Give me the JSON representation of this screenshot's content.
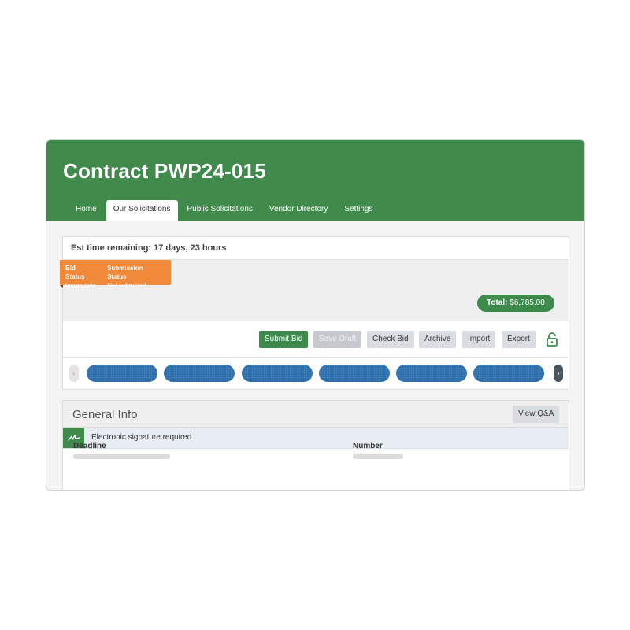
{
  "header": {
    "title": "Contract PWP24-015",
    "background": "#408a4c",
    "nav": [
      {
        "label": "Home",
        "active": false
      },
      {
        "label": "Our Solicitations",
        "active": true
      },
      {
        "label": "Public Solicitations",
        "active": false
      },
      {
        "label": "Vendor Directory",
        "active": false
      },
      {
        "label": "Settings",
        "active": false
      }
    ]
  },
  "bid": {
    "time_remaining": "Est time remaining: 17 days, 23 hours",
    "status_badge": {
      "color": "#f0893a",
      "bid_status_label": "Bid Status",
      "bid_status_value": "Incomplete",
      "submission_status_label": "Submission Status",
      "submission_status_value": "Not submitted"
    },
    "total_label": "Total:",
    "total_value": "$6,785.00"
  },
  "toolbar": {
    "submit_label": "Submit Bid",
    "save_draft_label": "Save Draft",
    "check_label": "Check Bid",
    "archive_label": "Archive",
    "import_label": "Import",
    "export_label": "Export",
    "lock_icon": "unlock-icon"
  },
  "carousel": {
    "left_icon": "chevron-left-icon",
    "right_icon": "chevron-right-icon",
    "pill_count": 6,
    "pill_color": "#2d6ca6"
  },
  "general_info": {
    "title": "General Info",
    "qa_label": "View Q&A",
    "signature_text": "Electronic signature required",
    "signature_icon": "signature-icon",
    "deadline_label": "Deadline",
    "number_label": "Number"
  }
}
